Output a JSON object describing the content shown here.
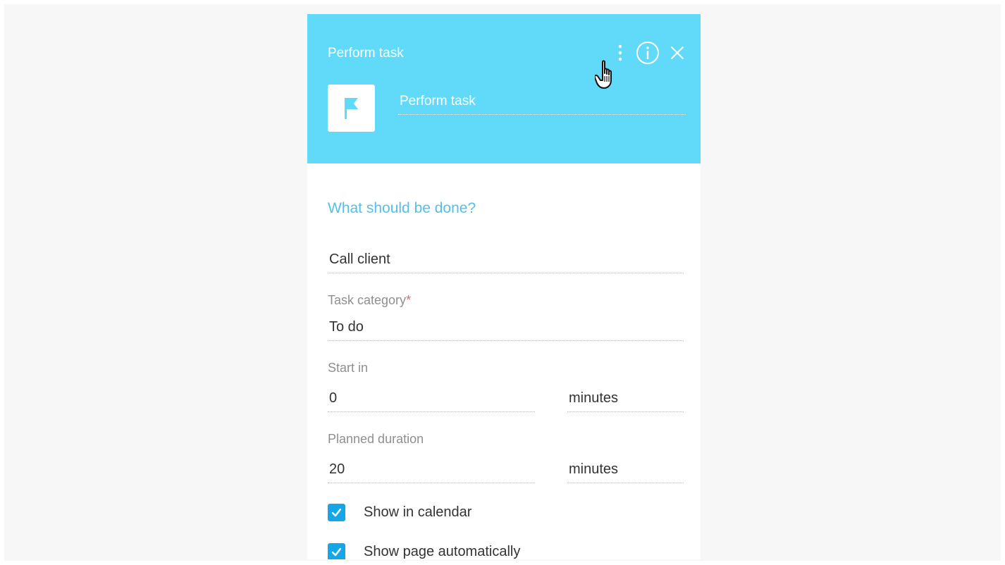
{
  "header": {
    "title": "Perform task",
    "element_name": "Perform task",
    "actions": [
      "kebab-menu-icon",
      "info-icon",
      "close-icon"
    ]
  },
  "form": {
    "section_title": "What should be done?",
    "task_value": "Call client",
    "category": {
      "label": "Task category",
      "required_mark": "*",
      "value": "To do"
    },
    "start_in": {
      "label": "Start in",
      "value": "0",
      "unit": "minutes"
    },
    "planned_duration": {
      "label": "Planned duration",
      "value": "20",
      "unit": "minutes"
    },
    "checkboxes": [
      {
        "label": "Show in calendar",
        "checked": true
      },
      {
        "label": "Show page automatically",
        "checked": true
      }
    ]
  },
  "colors": {
    "header_background": "#61DAFA",
    "accent_text": "#55BFE8",
    "checkbox": "#14A6E6",
    "required": "#D86B6B"
  },
  "icons": [
    "flag-icon",
    "hand-cursor-icon",
    "checkmark-icon"
  ]
}
